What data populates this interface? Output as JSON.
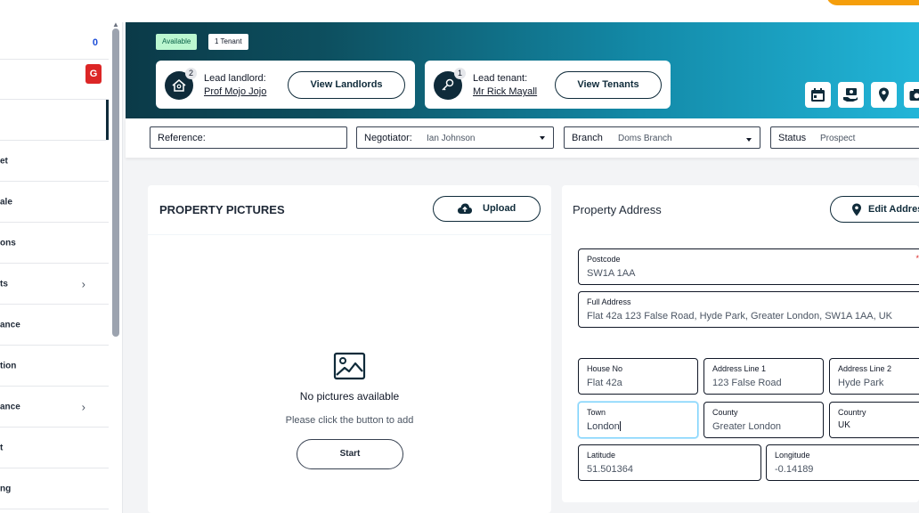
{
  "sidebar": {
    "items": [
      {
        "label": "",
        "count": "0"
      },
      {
        "label": "",
        "badge": "G"
      },
      {
        "label": ""
      },
      {
        "label": "et"
      },
      {
        "label": "ale"
      },
      {
        "label": "ons"
      },
      {
        "label": "ts",
        "chevron": "›"
      },
      {
        "label": "ance"
      },
      {
        "label": "tion"
      },
      {
        "label": "ance",
        "chevron": "›"
      },
      {
        "label": "t"
      },
      {
        "label": "ng"
      }
    ]
  },
  "header": {
    "status_badge": "Available",
    "tenant_badge": "1 Tenant",
    "landlord": {
      "count": "2",
      "role": "Lead landlord:",
      "name": "Prof Mojo Jojo",
      "button": "View Landlords"
    },
    "tenant": {
      "count": "1",
      "role": "Lead tenant:",
      "name": "Mr Rick Mayall",
      "button": "View Tenants"
    },
    "action_icons": [
      "calendar-icon",
      "money-hand-icon",
      "map-pin-icon",
      "camera-icon"
    ]
  },
  "filters": {
    "reference": {
      "label": "Reference:",
      "value": ""
    },
    "negotiator": {
      "label": "Negotiator:",
      "value": "Ian Johnson"
    },
    "branch": {
      "label": "Branch",
      "value": "Doms Branch"
    },
    "status": {
      "label": "Status",
      "value": "Prospect"
    }
  },
  "pictures": {
    "title": "PROPERTY PICTURES",
    "upload_label": "Upload",
    "empty_title": "No pictures available",
    "empty_subtitle": "Please click the button to add",
    "start_label": "Start"
  },
  "address": {
    "title": "Property Address",
    "edit_label": "Edit Address",
    "required_mark": "*",
    "postcode": {
      "label": "Postcode",
      "value": "SW1A 1AA"
    },
    "full_address": {
      "label": "Full Address",
      "value": "Flat 42a 123 False Road, Hyde Park, Greater London, SW1A 1AA, UK"
    },
    "house_no": {
      "label": "House No",
      "value": "Flat 42a"
    },
    "line1": {
      "label": "Address Line 1",
      "value": "123 False Road"
    },
    "line2": {
      "label": "Address Line 2",
      "value": "Hyde Park"
    },
    "town": {
      "label": "Town",
      "value": "London"
    },
    "county": {
      "label": "County",
      "value": "Greater London"
    },
    "country": {
      "label": "Country",
      "value": "UK"
    },
    "latitude": {
      "label": "Latitude",
      "value": "51.501364"
    },
    "longitude": {
      "label": "Longitude",
      "value": "-0.14189"
    }
  },
  "colors": {
    "brand_dark": "#0f2b3a",
    "banner_start": "#0b3a48",
    "banner_end": "#22b5d8",
    "available_bg": "#bbf7d0",
    "alert_red": "#dc2626",
    "accent_orange": "#f59e0b"
  }
}
